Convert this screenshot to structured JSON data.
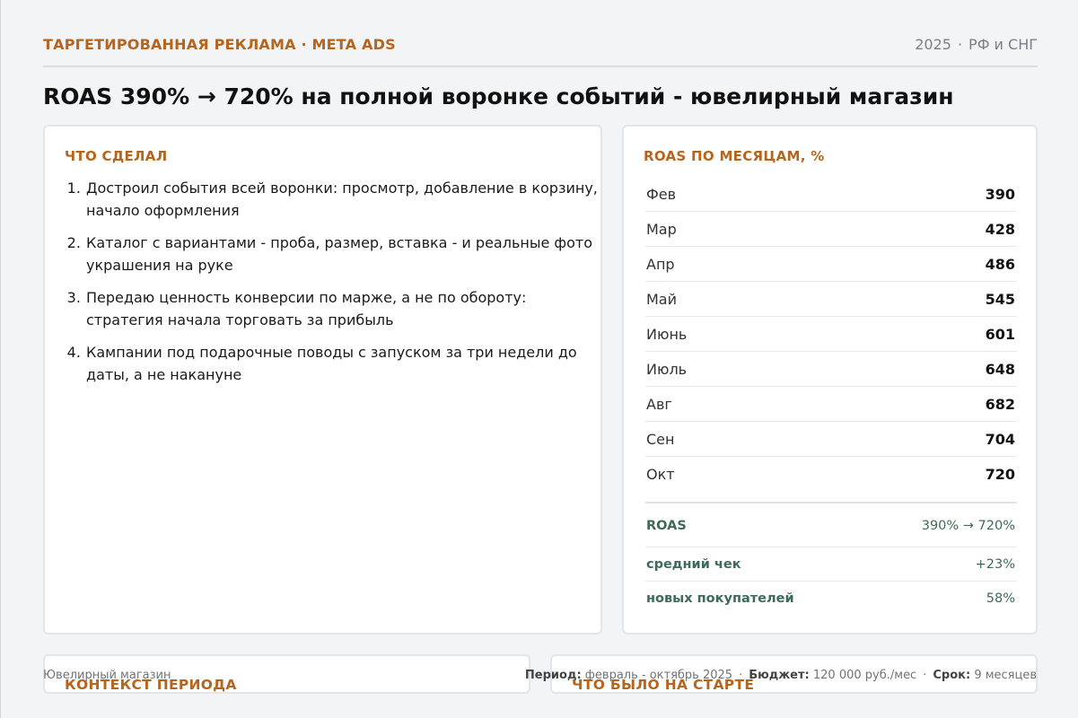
{
  "header": {
    "kicker": "ТАРГЕТИРОВАННАЯ РЕКЛАМА · META ADS",
    "year": "2025",
    "region": "РФ и СНГ"
  },
  "title": "ROAS 390% → 720% на полной воронке событий - ювелирный магазин",
  "left_card": {
    "heading": "ЧТО СДЕЛАЛ",
    "steps": [
      "Достроил события всей воронки: просмотр, добавление в корзину, начало оформления",
      "Каталог с вариантами - проба, размер, вставка - и реальные фото украшения на руке",
      "Передаю ценность конверсии по марже, а не по обороту: стратегия начала торговать за прибыль",
      "Кампании под подарочные поводы с запуском за три недели до даты, а не накануне"
    ]
  },
  "right_card": {
    "heading": "ROAS ПО МЕСЯЦАМ, %",
    "months": [
      {
        "month": "Фев",
        "value": "390"
      },
      {
        "month": "Мар",
        "value": "428"
      },
      {
        "month": "Апр",
        "value": "486"
      },
      {
        "month": "Май",
        "value": "545"
      },
      {
        "month": "Июнь",
        "value": "601"
      },
      {
        "month": "Июль",
        "value": "648"
      },
      {
        "month": "Авг",
        "value": "682"
      },
      {
        "month": "Сен",
        "value": "704"
      },
      {
        "month": "Окт",
        "value": "720"
      }
    ],
    "summary": [
      {
        "label": "ROAS",
        "value": "390% → 720%"
      },
      {
        "label": "средний чек",
        "value": "+23%"
      },
      {
        "label": "новых покупателей",
        "value": "58%"
      }
    ]
  },
  "bottom_left": {
    "heading": "КОНТЕКСТ ПЕРИОДА"
  },
  "bottom_right": {
    "heading": "ЧТО БЫЛО НА СТАРТЕ"
  },
  "footer": {
    "client": "Ювелирный магазин",
    "period_label": "Период:",
    "period_value": "февраль - октябрь 2025",
    "budget_label": "Бюджет:",
    "budget_value": "120 000 руб./мес",
    "term_label": "Срок:",
    "term_value": "9 месяцев"
  },
  "colors": {
    "accent": "#b5651d",
    "summary_green": "#3d6b55",
    "background": "#f3f4f6"
  }
}
